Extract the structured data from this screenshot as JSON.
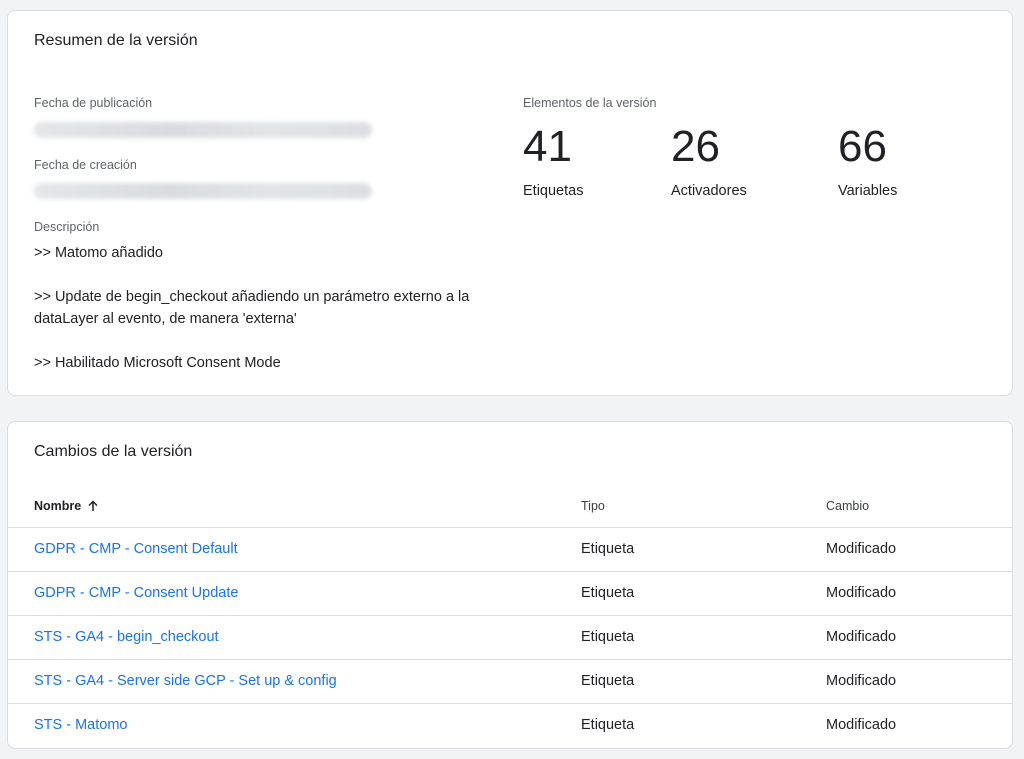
{
  "summary": {
    "title": "Resumen de la versión",
    "publish_date_label": "Fecha de publicación",
    "creation_date_label": "Fecha de creación",
    "description_label": "Descripción",
    "description_lines": [
      ">> Matomo añadido",
      ">> Update de begin_checkout añadiendo un parámetro externo a la dataLayer al evento, de manera 'externa'",
      ">> Habilitado Microsoft Consent Mode"
    ],
    "elements_label": "Elementos de la versión",
    "stats": [
      {
        "number": "41",
        "label": "Etiquetas"
      },
      {
        "number": "26",
        "label": "Activadores"
      },
      {
        "number": "66",
        "label": "Variables"
      }
    ]
  },
  "changes": {
    "title": "Cambios de la versión",
    "columns": {
      "name": "Nombre",
      "type": "Tipo",
      "change": "Cambio"
    },
    "rows": [
      {
        "name": "GDPR - CMP - Consent Default",
        "type": "Etiqueta",
        "change": "Modificado"
      },
      {
        "name": "GDPR - CMP - Consent Update",
        "type": "Etiqueta",
        "change": "Modificado"
      },
      {
        "name": "STS - GA4 - begin_checkout",
        "type": "Etiqueta",
        "change": "Modificado"
      },
      {
        "name": "STS - GA4 - Server side GCP - Set up & config",
        "type": "Etiqueta",
        "change": "Modificado"
      },
      {
        "name": "STS - Matomo",
        "type": "Etiqueta",
        "change": "Modificado"
      }
    ]
  },
  "colors": {
    "link": "#1a73e8",
    "text": "#202124",
    "secondary": "#5f6368",
    "background": "#f1f3f4"
  }
}
